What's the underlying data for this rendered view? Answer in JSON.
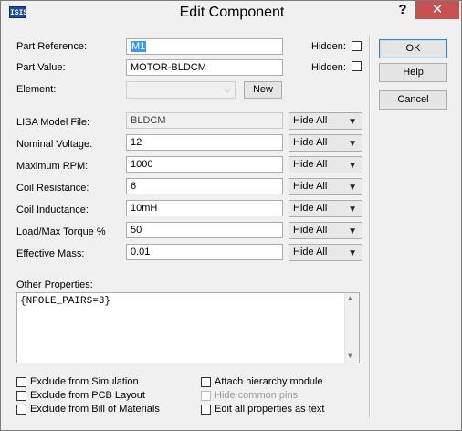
{
  "titlebar": {
    "app_icon": "ISIS",
    "title": "Edit Component",
    "help_glyph": "?",
    "close_glyph": "✕"
  },
  "fields": {
    "part_reference_label": "Part Reference:",
    "part_reference_value": "M1",
    "part_value_label": "Part Value:",
    "part_value_value": "MOTOR-BLDCM",
    "element_label": "Element:",
    "element_value": "",
    "new_button": "New",
    "hidden_label": "Hidden:"
  },
  "properties": [
    {
      "label": "LISA Model File:",
      "value": "BLDCM",
      "visibility": "Hide All"
    },
    {
      "label": "Nominal Voltage:",
      "value": "12",
      "visibility": "Hide All"
    },
    {
      "label": "Maximum RPM:",
      "value": "1000",
      "visibility": "Hide All"
    },
    {
      "label": "Coil Resistance:",
      "value": "6",
      "visibility": "Hide All"
    },
    {
      "label": "Coil Inductance:",
      "value": "10mH",
      "visibility": "Hide All"
    },
    {
      "label": "Load/Max Torque %",
      "value": "50",
      "visibility": "Hide All"
    },
    {
      "label": "Effective Mass:",
      "value": "0.01",
      "visibility": "Hide All"
    }
  ],
  "other_properties": {
    "label": "Other Properties:",
    "text": "{NPOLE_PAIRS=3}"
  },
  "buttons": {
    "ok": "OK",
    "help": "Help",
    "cancel": "Cancel"
  },
  "options": {
    "exclude_simulation": "Exclude from Simulation",
    "exclude_pcb": "Exclude from PCB Layout",
    "exclude_bom": "Exclude from Bill of Materials",
    "attach_hierarchy": "Attach hierarchy module",
    "hide_common_pins": "Hide common pins",
    "edit_all_text": "Edit all properties as text"
  },
  "colors": {
    "close": "#c75050",
    "selection": "#3399ff"
  }
}
